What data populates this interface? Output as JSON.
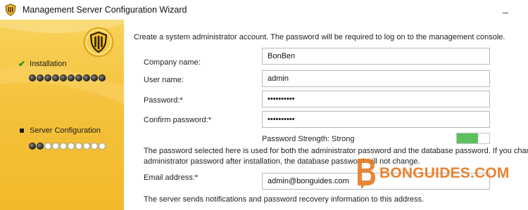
{
  "window": {
    "title": "Management Server Configuration Wizard",
    "minimize_glyph": "_"
  },
  "sidebar": {
    "steps": [
      {
        "label": "Installation",
        "state": "complete",
        "icon": "check-icon",
        "progress_filled": 10,
        "progress_total": 10
      },
      {
        "label": "Server Configuration",
        "state": "current",
        "icon": "bullet-icon",
        "progress_filled": 2,
        "progress_total": 10
      }
    ]
  },
  "form": {
    "intro": "Create a system administrator account. The password will be required to log on to the management console.",
    "company_label": "Company name:",
    "company_value": "BonBen",
    "username_label": "User name:",
    "username_value": "admin",
    "password_label": "Password:*",
    "password_value": "••••••••••",
    "confirm_label": "Confirm password:*",
    "confirm_value": "••••••••••",
    "strength_text": "Password Strength: Strong",
    "strength_level": 0.66,
    "strength_color": "#5cc05c",
    "note_line1": "The password selected here is used for both the administrator password and the database password. If you chang",
    "note_line2": "administrator password after installation, the database password will not change.",
    "email_label": "Email address:*",
    "email_value": "admin@bonguides.com",
    "email_note": "The server sends notifications and password recovery information to this address."
  },
  "watermark": {
    "text": "BONGUIDES.COM",
    "color": "#e67a23"
  }
}
